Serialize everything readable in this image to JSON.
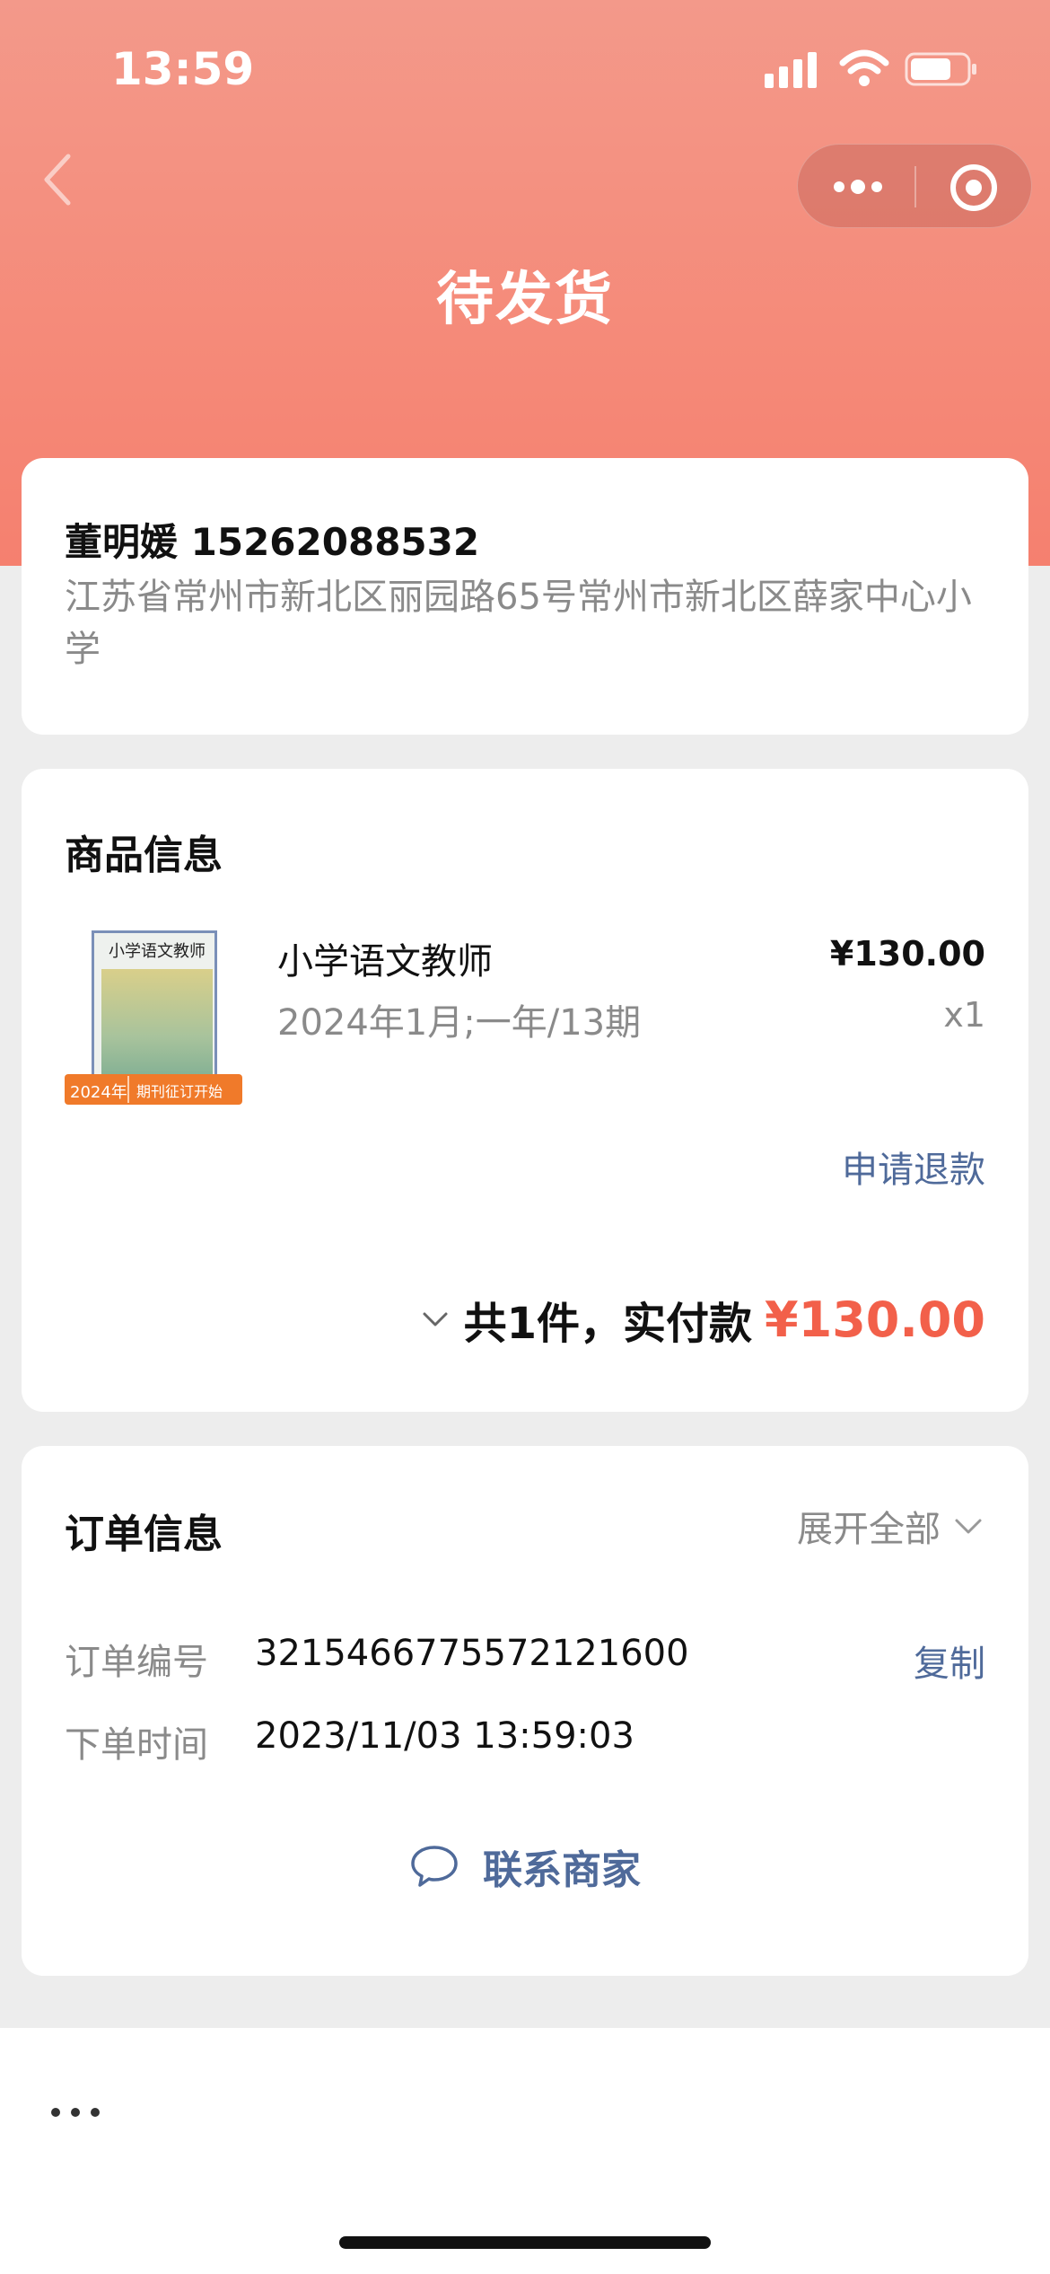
{
  "status_bar": {
    "time": "13:59"
  },
  "nav": {
    "title": "待发货"
  },
  "address": {
    "name_phone": "董明媛 15262088532",
    "detail": "江苏省常州市新北区丽园路65号常州市新北区薛家中心小学"
  },
  "goods": {
    "section_title": "商品信息",
    "cover": {
      "title": "小学语文教师",
      "banner_year": "2024年",
      "banner_text": "期刊征订开始"
    },
    "product_name": "小学语文教师",
    "product_spec": "2024年1月;一年/13期",
    "price": "¥130.00",
    "quantity": "x1",
    "refund_label": "申请退款",
    "total_label": "共1件，实付款",
    "total_amount": "¥130.00"
  },
  "order": {
    "section_title": "订单信息",
    "expand_label": "展开全部",
    "rows": [
      {
        "label": "订单编号",
        "value": "3215466775572121600"
      },
      {
        "label": "下单时间",
        "value": "2023/11/03 13:59:03"
      }
    ],
    "copy_label": "复制",
    "contact_label": "联系商家"
  },
  "colors": {
    "header_gradient_top": "#f3998a",
    "header_gradient_bottom": "#f5806f",
    "price_red": "#f2604a",
    "link_blue": "#4f6a9a"
  },
  "icons": [
    "back-chevron-icon",
    "more-dots-icon",
    "target-icon",
    "chevron-down-icon",
    "chat-bubble-icon",
    "signal-icon",
    "wifi-icon",
    "battery-icon"
  ]
}
